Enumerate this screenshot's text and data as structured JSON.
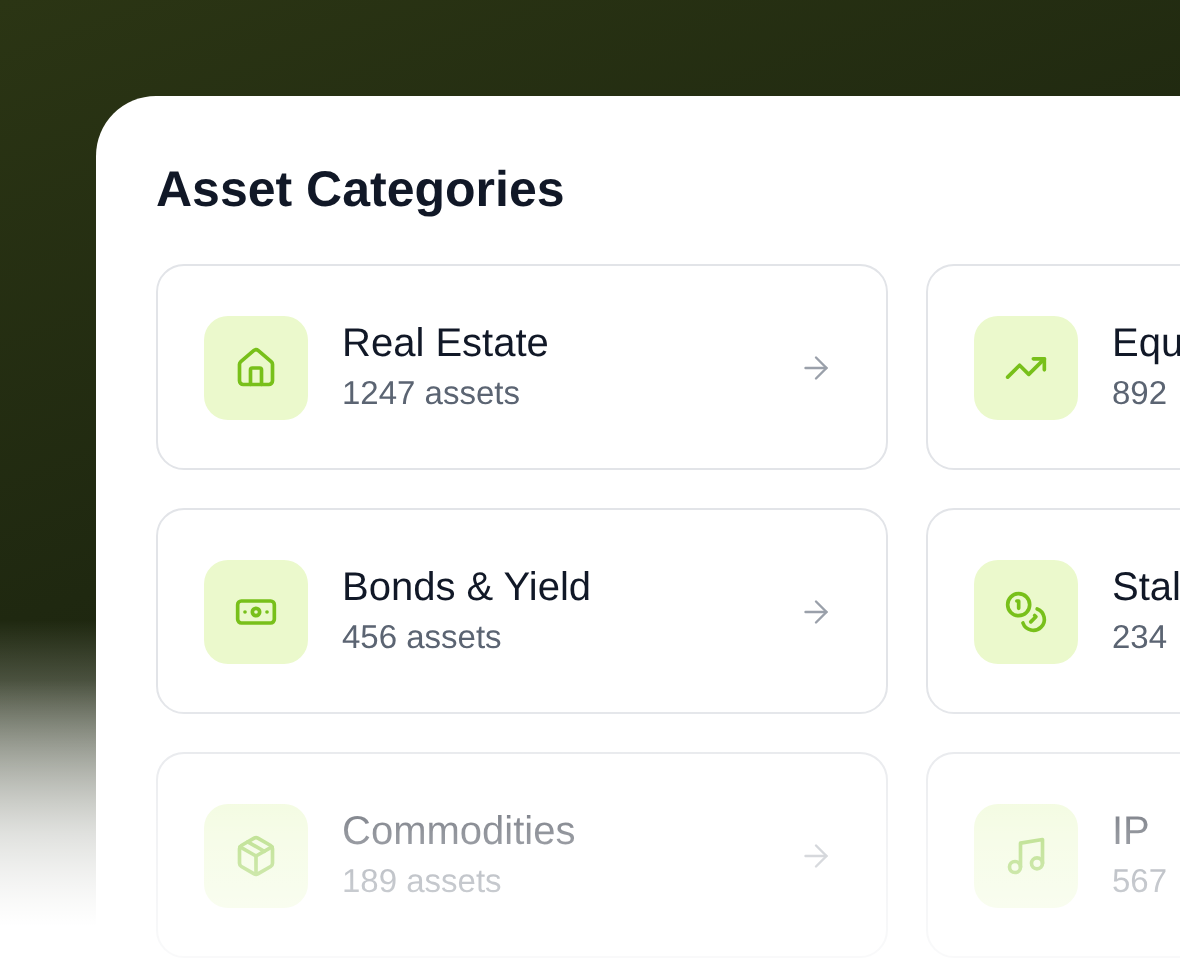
{
  "title": "Asset Categories",
  "categories": [
    {
      "name": "Real Estate",
      "count": "1247 assets"
    },
    {
      "name": "Equ",
      "count": "892"
    },
    {
      "name": "Bonds & Yield",
      "count": "456 assets"
    },
    {
      "name": "Stal",
      "count": "234"
    },
    {
      "name": "Commodities",
      "count": "189 assets"
    },
    {
      "name": "IP",
      "count": "567"
    }
  ]
}
